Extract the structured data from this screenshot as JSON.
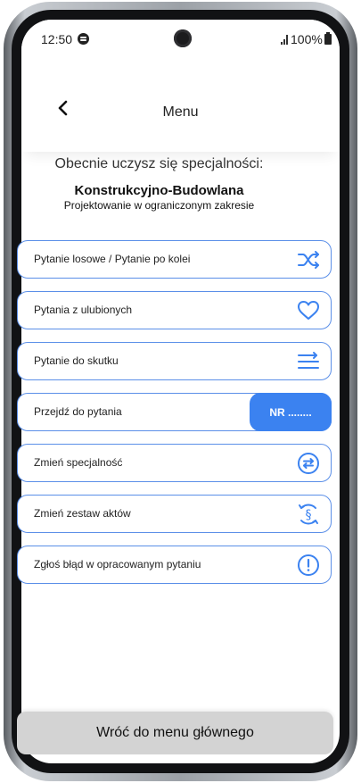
{
  "status_bar": {
    "time": "12:50",
    "battery": "100%",
    "icons": [
      "spotify-icon",
      "camera",
      "signal-icon",
      "battery-icon"
    ]
  },
  "header": {
    "back_icon": "chevron-left-icon",
    "title": "Menu"
  },
  "specialty": {
    "intro": "Obecnie uczysz się specjalności:",
    "name": "Konstrukcyjno-Budowlana",
    "scope": "Projektowanie w ograniczonym zakresie"
  },
  "menu": {
    "items": [
      {
        "label": "Pytanie losowe / Pytanie po kolei",
        "icon": "shuffle-icon"
      },
      {
        "label": "Pytania z ulubionych",
        "icon": "heart-icon"
      },
      {
        "label": "Pytanie do skutku",
        "icon": "list-arrow-icon"
      },
      {
        "label": "Przejdź do pytania",
        "icon": "nr-input",
        "pill": "NR ........"
      },
      {
        "label": "Zmień specjalność",
        "icon": "swap-circle-icon"
      },
      {
        "label": "Zmień zestaw aktów",
        "icon": "paragraph-refresh-icon"
      },
      {
        "label": "Zgłoś błąd w opracowanym pytaniu",
        "icon": "alert-circle-icon"
      }
    ]
  },
  "footer": {
    "main_menu_button": "Wróć do menu głównego"
  },
  "colors": {
    "accent": "#3b82f0",
    "border": "#5b8fe8",
    "bottom_button": "#d3d3d3"
  }
}
